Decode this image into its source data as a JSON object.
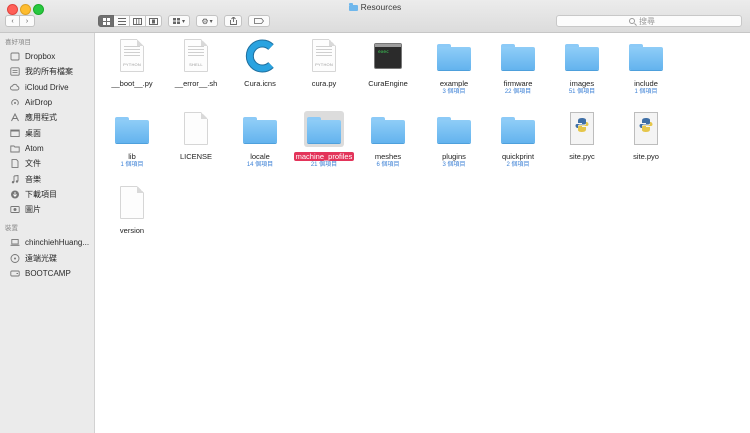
{
  "window": {
    "title": "Resources"
  },
  "toolbar": {
    "back_label": "‹",
    "forward_label": "›",
    "view_modes": [
      "icon-view",
      "list-view",
      "column-view",
      "cover-flow-view"
    ],
    "arrange_label": "▾",
    "action_label": "▾",
    "search_placeholder": "搜尋"
  },
  "sidebar": {
    "favorites_header": "喜好項目",
    "favorites": [
      {
        "label": "Dropbox",
        "icon": "dropbox-icon"
      },
      {
        "label": "我的所有檔案",
        "icon": "all-files-icon"
      },
      {
        "label": "iCloud Drive",
        "icon": "cloud-icon"
      },
      {
        "label": "AirDrop",
        "icon": "airdrop-icon"
      },
      {
        "label": "應用程式",
        "icon": "applications-icon"
      },
      {
        "label": "桌面",
        "icon": "desktop-icon"
      },
      {
        "label": "Atom",
        "icon": "folder-icon"
      },
      {
        "label": "文件",
        "icon": "documents-icon"
      },
      {
        "label": "音樂",
        "icon": "music-icon"
      },
      {
        "label": "下載項目",
        "icon": "downloads-icon"
      },
      {
        "label": "圖片",
        "icon": "pictures-icon"
      }
    ],
    "devices_header": "裝置",
    "devices": [
      {
        "label": "chinchiehHuang...",
        "icon": "laptop-icon"
      },
      {
        "label": "遠端光碟",
        "icon": "disc-icon"
      },
      {
        "label": "BOOTCAMP",
        "icon": "drive-icon"
      }
    ]
  },
  "files": [
    {
      "name": "__boot__.py",
      "kind": "python-doc",
      "doc_label": "PYTHON",
      "count": ""
    },
    {
      "name": "__error__.sh",
      "kind": "shell-doc",
      "doc_label": "SHELL",
      "count": ""
    },
    {
      "name": "Cura.icns",
      "kind": "cura-icon",
      "count": ""
    },
    {
      "name": "cura.py",
      "kind": "python-doc",
      "doc_label": "PYTHON",
      "count": ""
    },
    {
      "name": "CuraEngine",
      "kind": "terminal",
      "term_text": "exec",
      "count": ""
    },
    {
      "name": "example",
      "kind": "folder",
      "count": "3 個項目"
    },
    {
      "name": "firmware",
      "kind": "folder",
      "count": "22 個項目"
    },
    {
      "name": "images",
      "kind": "folder",
      "count": "51 個項目"
    },
    {
      "name": "include",
      "kind": "folder",
      "count": "1 個項目"
    },
    {
      "name": "lib",
      "kind": "folder",
      "count": "1 個項目"
    },
    {
      "name": "LICENSE",
      "kind": "blank-doc",
      "count": ""
    },
    {
      "name": "locale",
      "kind": "folder",
      "count": "14 個項目"
    },
    {
      "name": "machine_profiles",
      "kind": "folder",
      "count": "21 個項目",
      "selected": true
    },
    {
      "name": "meshes",
      "kind": "folder",
      "count": "6 個項目"
    },
    {
      "name": "plugins",
      "kind": "folder",
      "count": "3 個項目"
    },
    {
      "name": "quickprint",
      "kind": "folder",
      "count": "2 個項目"
    },
    {
      "name": "site.pyc",
      "kind": "python-compiled",
      "count": ""
    },
    {
      "name": "site.pyo",
      "kind": "python-compiled",
      "count": ""
    },
    {
      "name": "version",
      "kind": "blank-doc",
      "count": ""
    }
  ],
  "colors": {
    "folder": "#6fb7ec",
    "selection": "#e3345a",
    "count_text": "#3e82d6",
    "sidebar_bg": "#ebebeb"
  }
}
